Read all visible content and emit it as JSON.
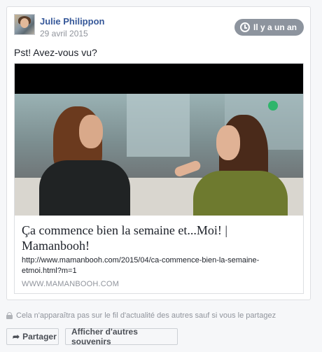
{
  "post": {
    "author": "Julie Philippon",
    "date": "29 avril 2015",
    "badge": "Il y a un an",
    "text": "Pst! Avez-vous vu?"
  },
  "link": {
    "title": "Ça commence bien la semaine et...Moi! | Mamanbooh!",
    "url": "http://www.mamanbooh.com/2015/04/ca-commence-bien-la-semaine-etmoi.html?m=1",
    "domain": "WWW.MAMANBOOH.COM"
  },
  "footer": {
    "notice": "Cela n'apparaîtra pas sur le fil d'actualité des autres sauf si vous le partagez",
    "share_label": "Partager",
    "more_label": "Afficher d'autres souvenirs"
  },
  "icons": {
    "badge": "clock-icon",
    "notice": "lock-icon",
    "share": "share-arrow-icon"
  }
}
